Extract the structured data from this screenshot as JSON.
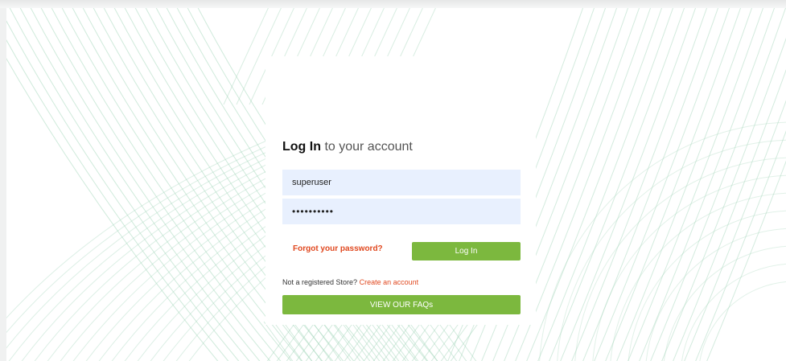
{
  "login": {
    "title_bold": "Log In",
    "title_rest": "to your account",
    "username_value": "superuser",
    "password_value": "••••••••••",
    "forgot_label": "Forgot your password?",
    "login_label": "Log In",
    "register_prompt": "Not a registered Store?",
    "register_link": "Create an account",
    "faq_label": "VIEW OUR FAQs"
  },
  "colors": {
    "accent_green": "#7cb83e",
    "link_orange": "#e0481f",
    "field_bg": "#e8f0fe",
    "background_lines": "#a8d8bd"
  }
}
